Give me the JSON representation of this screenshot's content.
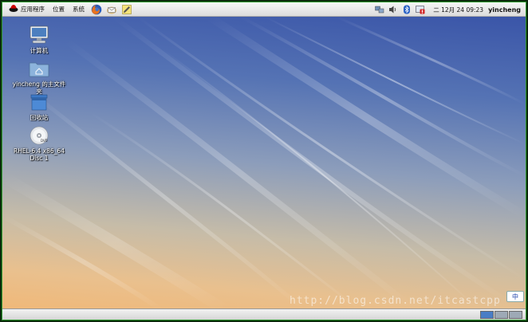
{
  "top_panel": {
    "menus": [
      {
        "label": "应用程序",
        "icon": "redhat-icon"
      },
      {
        "label": "位置"
      },
      {
        "label": "系统"
      }
    ],
    "launchers": [
      "firefox-icon",
      "mail-icon",
      "notes-icon"
    ],
    "tray": [
      "network-icon",
      "volume-icon",
      "bluetooth-icon",
      "update-icon"
    ],
    "clock": "二 12月 24 09:23",
    "username": "yincheng"
  },
  "desktop": {
    "icons": [
      {
        "label": "计算机",
        "icon": "computer-icon"
      },
      {
        "label": "yincheng 的主文件夹",
        "icon": "home-folder-icon"
      },
      {
        "label": "回收站",
        "icon": "trash-icon"
      },
      {
        "label": "RHEL-6.4 x86_64\nDisc 1",
        "icon": "dvd-icon"
      }
    ],
    "watermark": "http://blog.csdn.net/itcastcpp",
    "ime_label": "中"
  },
  "bottom_panel": {
    "workspaces": [
      {
        "active": true
      },
      {
        "active": false
      },
      {
        "active": false
      }
    ]
  },
  "colors": {
    "panel": "#e6e6e6",
    "workspace_active": "#4a7dc5",
    "desktop_top": "#3a55a8",
    "desktop_bottom": "#f0b878"
  }
}
